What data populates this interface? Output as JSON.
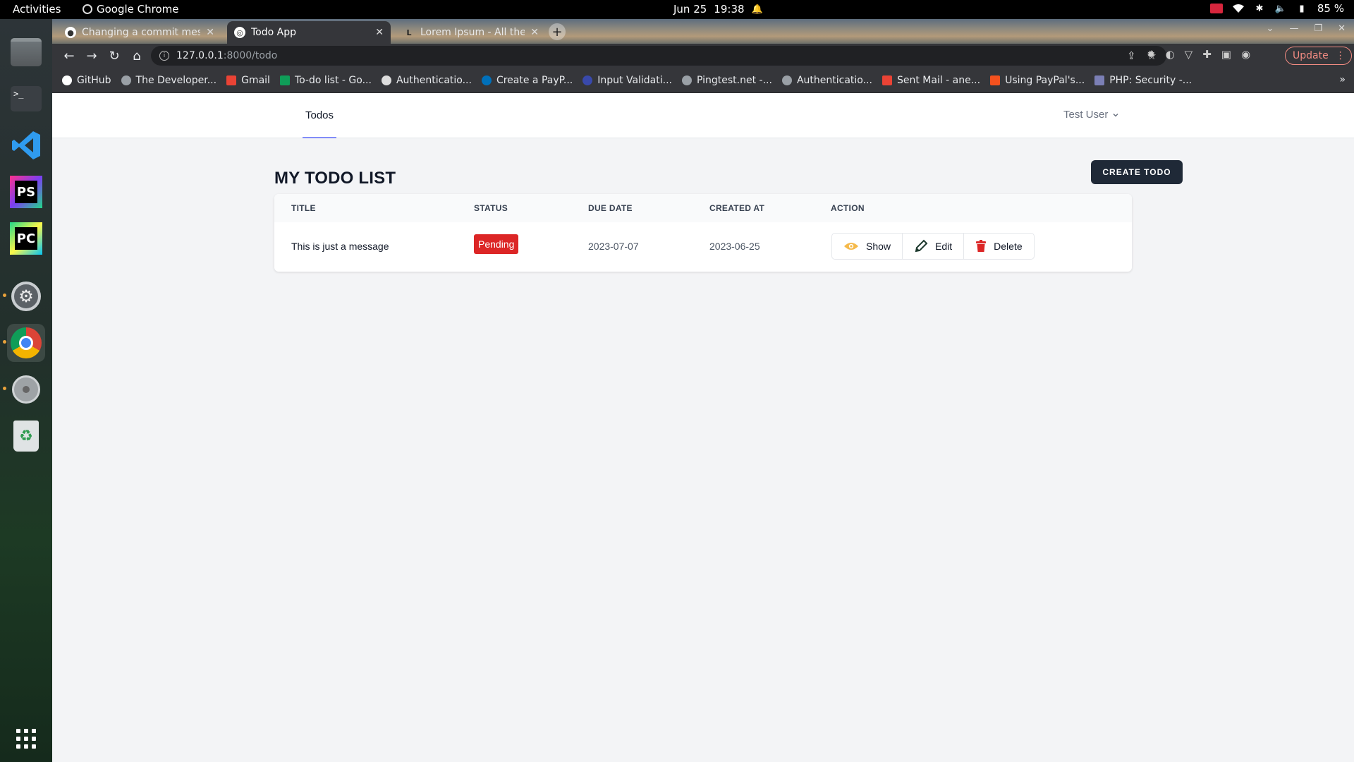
{
  "system": {
    "activities": "Activities",
    "app_name": "Google Chrome",
    "date": "Jun 25",
    "time": "19:38",
    "battery": "85 %"
  },
  "browser": {
    "tabs": [
      {
        "label": "Changing a commit messa",
        "icon": "github-icon"
      },
      {
        "label": "Todo App",
        "icon": "globe-icon"
      },
      {
        "label": "Lorem Ipsum - All the fact",
        "icon": "lorem-icon"
      }
    ],
    "url_host": "127.0.0.1",
    "url_path": ":8000/todo",
    "update_label": "Update",
    "bookmarks": [
      "GitHub",
      "The Developer...",
      "Gmail",
      "To-do list - Go...",
      "Authenticatio...",
      "Create a PayP...",
      "Input Validati...",
      "Pingtest.net -...",
      "Authenticatio...",
      "Sent Mail - ane...",
      "Using PayPal's...",
      "PHP: Security -..."
    ],
    "bookmarks_more": "»"
  },
  "app": {
    "nav_todos": "Todos",
    "user_name": "Test User",
    "page_title": "MY TODO LIST",
    "create_button": "CREATE TODO",
    "table": {
      "headers": [
        "TITLE",
        "STATUS",
        "DUE DATE",
        "CREATED AT",
        "ACTION"
      ],
      "rows": [
        {
          "title": "This is just a message",
          "status": "Pending",
          "due_date": "2023-07-07",
          "created_at": "2023-06-25"
        }
      ],
      "actions": {
        "show": "Show",
        "edit": "Edit",
        "delete": "Delete"
      }
    }
  },
  "colors": {
    "badge_pending": "#dc2626",
    "primary_button": "#1f2937",
    "nav_active_underline": "#818cf8"
  }
}
